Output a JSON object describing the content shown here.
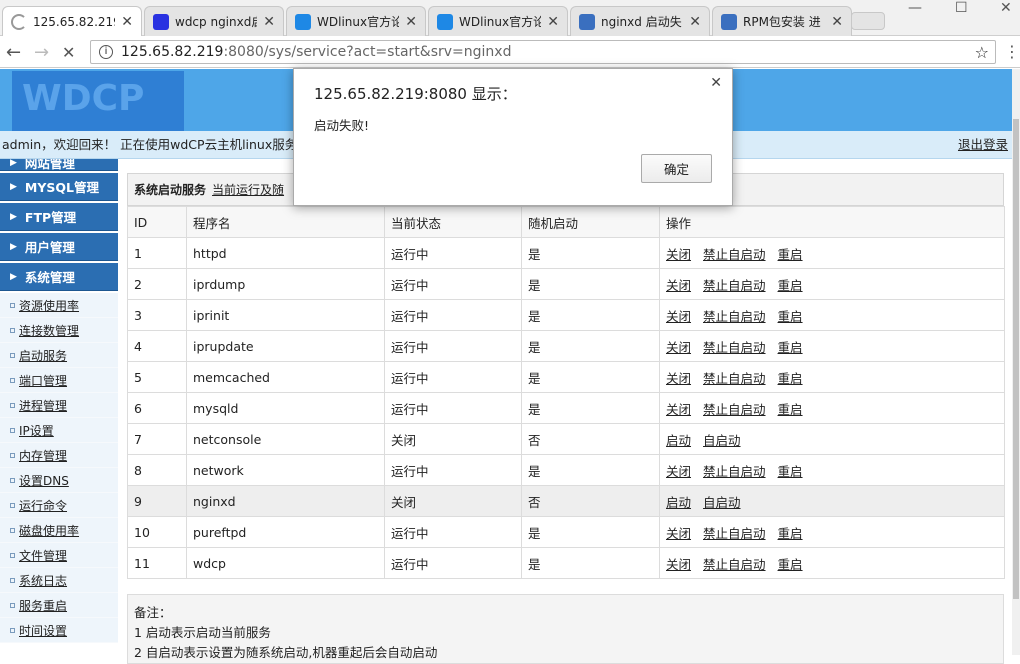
{
  "browser": {
    "tabs": [
      {
        "title": "125.65.82.219",
        "favicon": "loading-icon",
        "color": "#999999",
        "active": true
      },
      {
        "title": "wdcp nginxd启",
        "favicon": "baidu-paw-icon",
        "color": "#2932e1"
      },
      {
        "title": "WDlinux官方论",
        "favicon": "wdlinux-icon",
        "color": "#1e88e5"
      },
      {
        "title": "WDlinux官方论",
        "favicon": "wdlinux-icon",
        "color": "#1e88e5"
      },
      {
        "title": "nginxd 启动失",
        "favicon": "blog-icon",
        "color": "#3a6fbf"
      },
      {
        "title": "RPM包安装 进",
        "favicon": "blog-icon",
        "color": "#3a6fbf"
      }
    ],
    "url_host": "125.65.82.219",
    "url_path": ":8080/sys/service?act=start&srv=nginxd"
  },
  "header": {
    "logo_text": "WDCP",
    "welcome": "admin，欢迎回来！ 正在使用wdCP云主机linux服务器",
    "logout": "退出登录"
  },
  "sidebar": {
    "menus": [
      "网站管理",
      "MYSQL管理",
      "FTP管理",
      "用户管理",
      "系统管理"
    ],
    "items": [
      "资源使用率",
      "连接数管理",
      "启动服务",
      "端口管理",
      "进程管理",
      "IP设置",
      "内存管理",
      "设置DNS",
      "运行命令",
      "磁盘使用率",
      "文件管理",
      "系统日志",
      "服务重启",
      "时间设置"
    ]
  },
  "main": {
    "title": "系统启动服务",
    "title_link": "当前运行及随",
    "columns": [
      "ID",
      "程序名",
      "当前状态",
      "随机启动",
      "操作"
    ],
    "rows": [
      {
        "id": "1",
        "name": "httpd",
        "status": "运行中",
        "auto": "是",
        "ops": [
          "关闭",
          "禁止自启动",
          "重启"
        ]
      },
      {
        "id": "2",
        "name": "iprdump",
        "status": "运行中",
        "auto": "是",
        "ops": [
          "关闭",
          "禁止自启动",
          "重启"
        ]
      },
      {
        "id": "3",
        "name": "iprinit",
        "status": "运行中",
        "auto": "是",
        "ops": [
          "关闭",
          "禁止自启动",
          "重启"
        ]
      },
      {
        "id": "4",
        "name": "iprupdate",
        "status": "运行中",
        "auto": "是",
        "ops": [
          "关闭",
          "禁止自启动",
          "重启"
        ]
      },
      {
        "id": "5",
        "name": "memcached",
        "status": "运行中",
        "auto": "是",
        "ops": [
          "关闭",
          "禁止自启动",
          "重启"
        ]
      },
      {
        "id": "6",
        "name": "mysqld",
        "status": "运行中",
        "auto": "是",
        "ops": [
          "关闭",
          "禁止自启动",
          "重启"
        ]
      },
      {
        "id": "7",
        "name": "netconsole",
        "status": "关闭",
        "auto": "否",
        "ops": [
          "启动",
          "自启动"
        ]
      },
      {
        "id": "8",
        "name": "network",
        "status": "运行中",
        "auto": "是",
        "ops": [
          "关闭",
          "禁止自启动",
          "重启"
        ]
      },
      {
        "id": "9",
        "name": "nginxd",
        "status": "关闭",
        "auto": "否",
        "ops": [
          "启动",
          "自启动"
        ],
        "highlight": true
      },
      {
        "id": "10",
        "name": "pureftpd",
        "status": "运行中",
        "auto": "是",
        "ops": [
          "关闭",
          "禁止自启动",
          "重启"
        ]
      },
      {
        "id": "11",
        "name": "wdcp",
        "status": "运行中",
        "auto": "是",
        "ops": [
          "关闭",
          "禁止自启动",
          "重启"
        ]
      }
    ],
    "notes": [
      "备注：",
      "1 启动表示启动当前服务",
      "2 自启动表示设置为随系统启动,机器重起后会自动启动"
    ]
  },
  "dialog": {
    "title": "125.65.82.219:8080 显示：",
    "message": "启动失败!",
    "ok": "确定"
  }
}
